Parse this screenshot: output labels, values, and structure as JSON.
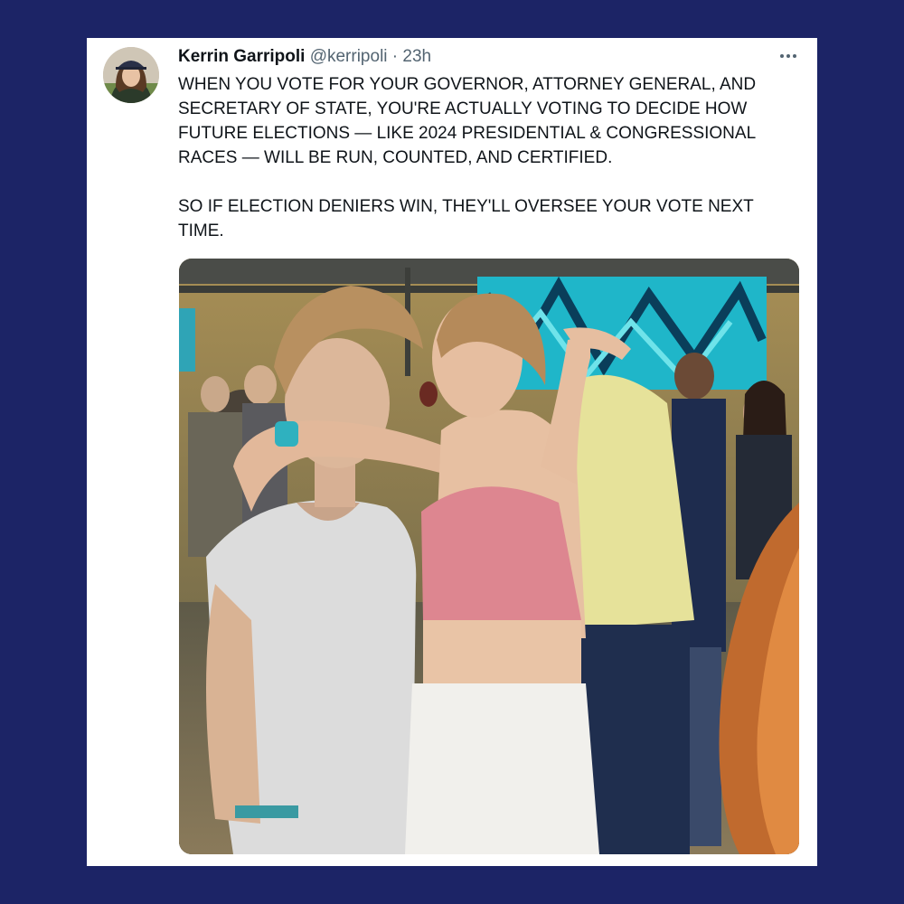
{
  "tweet": {
    "author_name": "Kerrin Garripoli",
    "author_handle": "@kerripoli",
    "separator": "·",
    "timestamp": "23h",
    "paragraphs": [
      "WHEN YOU VOTE FOR YOUR GOVERNOR, ATTORNEY GENERAL, AND SECRETARY OF STATE, YOU'RE ACTUALLY VOTING TO DECIDE HOW FUTURE ELECTIONS — LIKE 2024 PRESIDENTIAL & CONGRESSIONAL RACES — WILL BE RUN, COUNTED, AND CERTIFIED.",
      "SO IF ELECTION DENIERS WIN, THEY'LL OVERSEE YOUR VOTE NEXT TIME."
    ],
    "more_icon": "more-horizontal-icon",
    "media_description_icon": "photo"
  },
  "colors": {
    "background": "#1c2466",
    "card": "#ffffff",
    "text_primary": "#0f1419",
    "text_secondary": "#536471"
  }
}
